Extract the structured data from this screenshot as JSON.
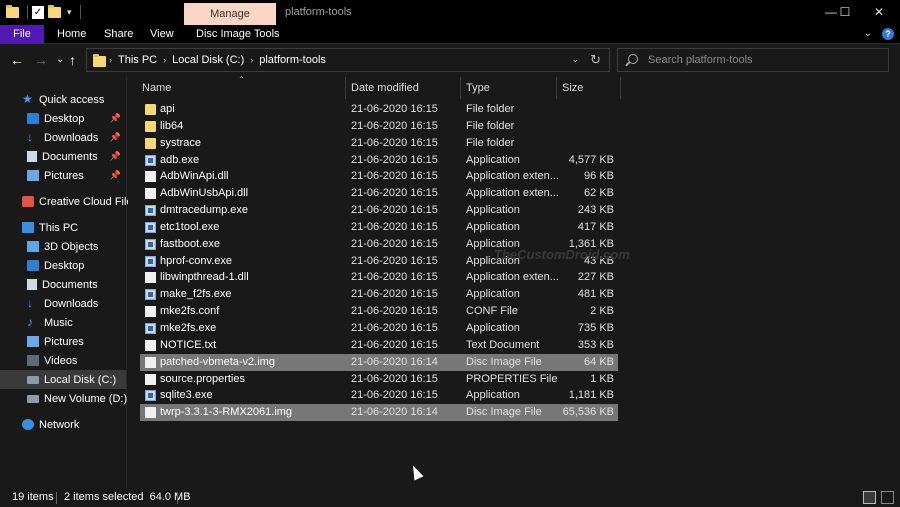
{
  "window": {
    "title": "platform-tools",
    "context_tab": "Manage",
    "controls": {
      "minimize": "—",
      "maximize": "☐",
      "close": "✕"
    }
  },
  "ribbon": {
    "tabs": [
      "File",
      "Home",
      "Share",
      "View",
      "Disc Image Tools"
    ],
    "accent": "#4f19b3"
  },
  "nav": {
    "back": "←",
    "forward": "→",
    "recent": "⌄",
    "up": "↑",
    "breadcrumb": [
      "This PC",
      "Local Disk (C:)",
      "platform-tools"
    ],
    "search_placeholder": "Search platform-tools"
  },
  "sidebar": {
    "items": [
      {
        "label": "Quick access",
        "icon": "star-icon",
        "pinned": false
      },
      {
        "label": "Desktop",
        "icon": "desktop-icon",
        "pinned": true
      },
      {
        "label": "Downloads",
        "icon": "download-icon",
        "pinned": true
      },
      {
        "label": "Documents",
        "icon": "documents-icon",
        "pinned": true
      },
      {
        "label": "Pictures",
        "icon": "pictures-icon",
        "pinned": true
      },
      {
        "label": "Creative Cloud Files",
        "icon": "creative-cloud-icon",
        "pinned": false
      },
      {
        "label": "This PC",
        "icon": "computer-icon",
        "pinned": false
      },
      {
        "label": "3D Objects",
        "icon": "3d-objects-icon",
        "pinned": false
      },
      {
        "label": "Desktop",
        "icon": "desktop-icon",
        "pinned": false
      },
      {
        "label": "Documents",
        "icon": "documents-icon",
        "pinned": false
      },
      {
        "label": "Downloads",
        "icon": "download-icon",
        "pinned": false
      },
      {
        "label": "Music",
        "icon": "music-icon",
        "pinned": false
      },
      {
        "label": "Pictures",
        "icon": "pictures-icon",
        "pinned": false
      },
      {
        "label": "Videos",
        "icon": "videos-icon",
        "pinned": false
      },
      {
        "label": "Local Disk (C:)",
        "icon": "disk-icon",
        "pinned": false,
        "selected": true
      },
      {
        "label": "New Volume (D:)",
        "icon": "disk-icon",
        "pinned": false
      },
      {
        "label": "Network",
        "icon": "network-icon",
        "pinned": false
      }
    ]
  },
  "columns": {
    "name": "Name",
    "date": "Date modified",
    "type": "Type",
    "size": "Size"
  },
  "files": [
    {
      "name": "api",
      "date": "21-06-2020 16:15",
      "type": "File folder",
      "size": "",
      "kind": "folder",
      "selected": false
    },
    {
      "name": "lib64",
      "date": "21-06-2020 16:15",
      "type": "File folder",
      "size": "",
      "kind": "folder",
      "selected": false
    },
    {
      "name": "systrace",
      "date": "21-06-2020 16:15",
      "type": "File folder",
      "size": "",
      "kind": "folder",
      "selected": false
    },
    {
      "name": "adb.exe",
      "date": "21-06-2020 16:15",
      "type": "Application",
      "size": "4,577 KB",
      "kind": "app",
      "selected": false
    },
    {
      "name": "AdbWinApi.dll",
      "date": "21-06-2020 16:15",
      "type": "Application exten...",
      "size": "96 KB",
      "kind": "file",
      "selected": false
    },
    {
      "name": "AdbWinUsbApi.dll",
      "date": "21-06-2020 16:15",
      "type": "Application exten...",
      "size": "62 KB",
      "kind": "file",
      "selected": false
    },
    {
      "name": "dmtracedump.exe",
      "date": "21-06-2020 16:15",
      "type": "Application",
      "size": "243 KB",
      "kind": "app",
      "selected": false
    },
    {
      "name": "etc1tool.exe",
      "date": "21-06-2020 16:15",
      "type": "Application",
      "size": "417 KB",
      "kind": "app",
      "selected": false
    },
    {
      "name": "fastboot.exe",
      "date": "21-06-2020 16:15",
      "type": "Application",
      "size": "1,361 KB",
      "kind": "app",
      "selected": false
    },
    {
      "name": "hprof-conv.exe",
      "date": "21-06-2020 16:15",
      "type": "Application",
      "size": "43 KB",
      "kind": "app",
      "selected": false
    },
    {
      "name": "libwinpthread-1.dll",
      "date": "21-06-2020 16:15",
      "type": "Application exten...",
      "size": "227 KB",
      "kind": "file",
      "selected": false
    },
    {
      "name": "make_f2fs.exe",
      "date": "21-06-2020 16:15",
      "type": "Application",
      "size": "481 KB",
      "kind": "app",
      "selected": false
    },
    {
      "name": "mke2fs.conf",
      "date": "21-06-2020 16:15",
      "type": "CONF File",
      "size": "2 KB",
      "kind": "file",
      "selected": false
    },
    {
      "name": "mke2fs.exe",
      "date": "21-06-2020 16:15",
      "type": "Application",
      "size": "735 KB",
      "kind": "app",
      "selected": false
    },
    {
      "name": "NOTICE.txt",
      "date": "21-06-2020 16:15",
      "type": "Text Document",
      "size": "353 KB",
      "kind": "file",
      "selected": false
    },
    {
      "name": "patched-vbmeta-v2.img",
      "date": "21-06-2020 16:14",
      "type": "Disc Image File",
      "size": "64 KB",
      "kind": "file",
      "selected": true
    },
    {
      "name": "source.properties",
      "date": "21-06-2020 16:15",
      "type": "PROPERTIES File",
      "size": "1 KB",
      "kind": "file",
      "selected": false
    },
    {
      "name": "sqlite3.exe",
      "date": "21-06-2020 16:15",
      "type": "Application",
      "size": "1,181 KB",
      "kind": "app",
      "selected": false
    },
    {
      "name": "twrp-3.3.1-3-RMX2061.img",
      "date": "21-06-2020 16:14",
      "type": "Disc Image File",
      "size": "65,536 KB",
      "kind": "file",
      "selected": true
    }
  ],
  "watermark": "TheCustomDroid.com",
  "status": {
    "items": "19 items",
    "selected": "2 items selected  64.0 MB"
  }
}
